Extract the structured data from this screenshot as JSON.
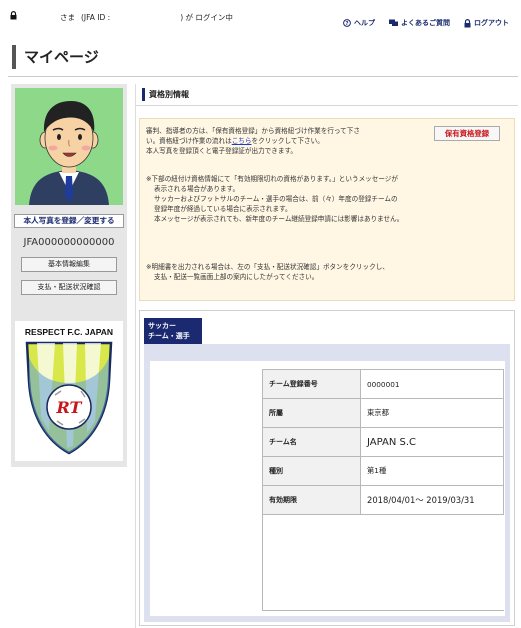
{
  "topbar": {
    "honorific": "さま",
    "jfa_id_label": "(JFA ID :",
    "login_suffix": ") が ログイン中",
    "help": "ヘルプ",
    "faq": "よくあるご質問",
    "logout": "ログアウト"
  },
  "page_title": "マイページ",
  "sidebar": {
    "photo_button": "本人写真を登録／変更する",
    "jfa_id": "JFA000000000000",
    "basic_info_button": "基本情報編集",
    "payment_button": "支払・配送状況確認",
    "emblem_text": "RESPECT F.C. JAPAN",
    "emblem_mark": "RT"
  },
  "section": {
    "title": "資格別情報"
  },
  "notice": {
    "line1": "審判、指導者の方は、「保有資格登録」から資格紐づけ作業を行って下さ",
    "line2a": "い。資格紐づけ作業の流れは",
    "line2_link": "こちら",
    "line2b": "をクリックして下さい。",
    "line3": "本人写真を登録頂くと電子登録証が出力できます。",
    "line4": "※下部の紐付け資格情報にて「有効期限切れの資格があります。」というメッセージが",
    "line5": "表示される場合があります。",
    "line6": "サッカーおよびフットサルのチーム・選手の場合は、前（々）年度の登録チームの",
    "line7": "登録年度が経過している場合に表示されます。",
    "line8": "本メッセージが表示されても、新年度のチーム継続登録申請には影響はありません。",
    "line9": "※明細書を出力される場合は、左の「支払・配送状況確認」ボタンをクリックし、",
    "line10": "支払・配送一覧画面上部の案内にしたがってください。",
    "qual_button": "保有資格登録"
  },
  "tab": {
    "line1": "サッカー",
    "line2": "チーム・選手"
  },
  "team_info": {
    "rows": [
      {
        "label": "チーム登録番号",
        "value": "0000001"
      },
      {
        "label": "所屬",
        "value": "東京都"
      },
      {
        "label": "チーム名",
        "value": "JAPAN S.C"
      },
      {
        "label": "種別",
        "value": "第1種"
      },
      {
        "label": "有効期限",
        "value": "2018/04/01～ 2019/03/31"
      }
    ]
  },
  "colors": {
    "navy": "#1b2a70",
    "avatar_bg": "#8ed88a",
    "notice_bg": "#fff7e4",
    "accent_red": "#c8151b"
  }
}
